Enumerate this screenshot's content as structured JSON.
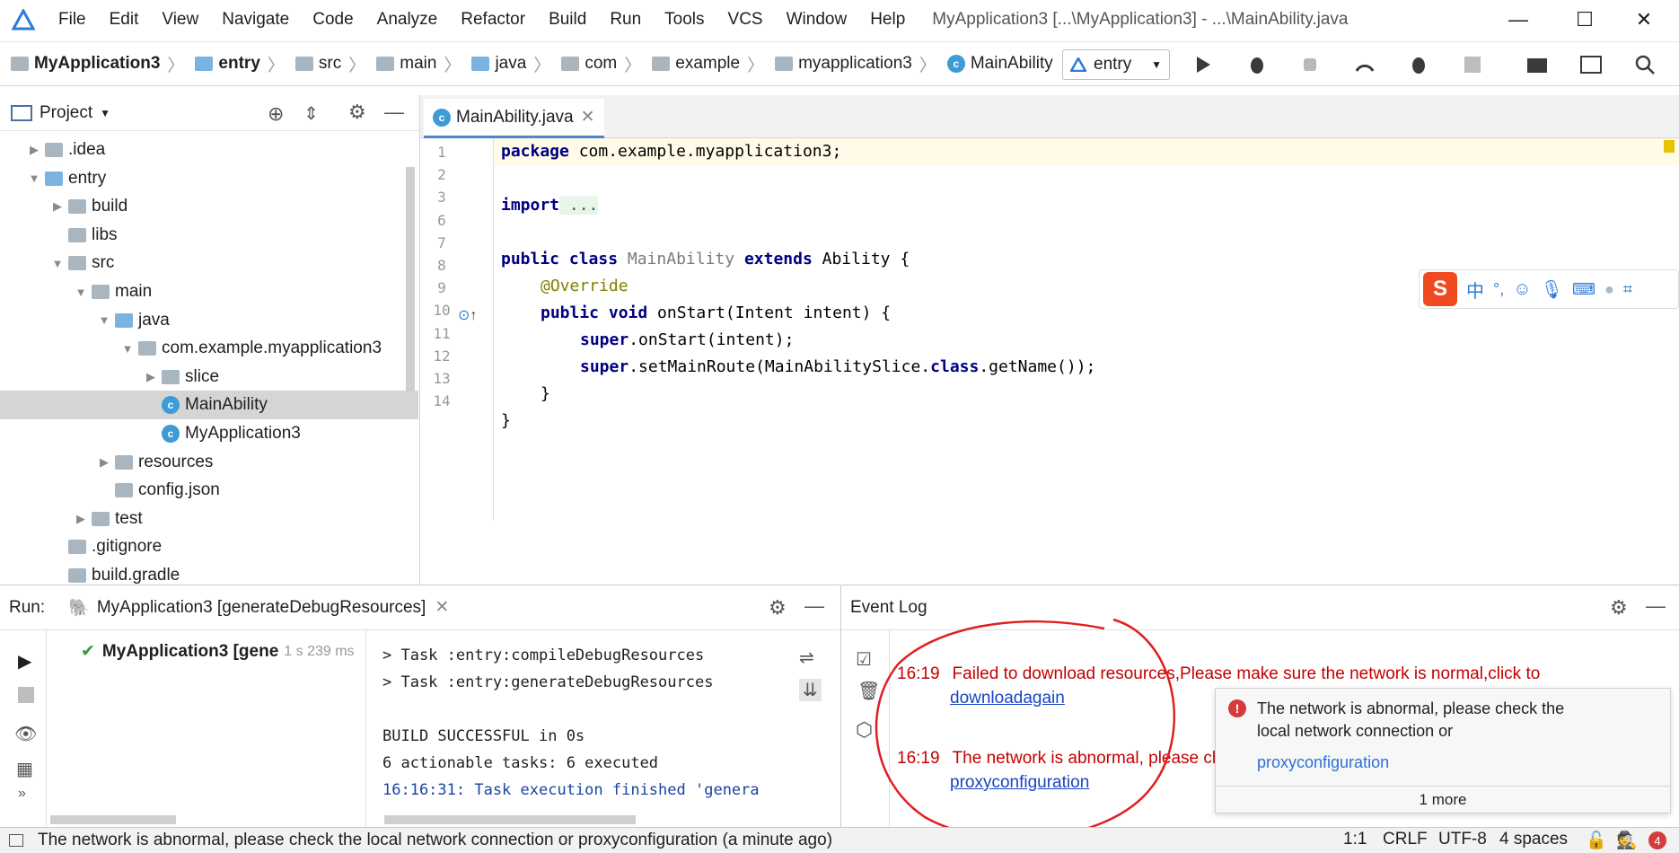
{
  "menubar": {
    "items": [
      "File",
      "Edit",
      "View",
      "Navigate",
      "Code",
      "Analyze",
      "Refactor",
      "Build",
      "Run",
      "Tools",
      "VCS",
      "Window",
      "Help"
    ],
    "title": "MyApplication3 [...\\MyApplication3] - ...\\MainAbility.java"
  },
  "navbar": {
    "crumbs": [
      "MyApplication3",
      "entry",
      "src",
      "main",
      "java",
      "com",
      "example",
      "myapplication3",
      "MainAbility"
    ],
    "run_config": "entry"
  },
  "project": {
    "header": "Project",
    "tree": [
      {
        "label": ".idea",
        "arrow": "▶",
        "indent": 0
      },
      {
        "label": "entry",
        "arrow": "▼",
        "indent": 0
      },
      {
        "label": "build",
        "arrow": "▶",
        "indent": 1
      },
      {
        "label": "libs",
        "arrow": "",
        "indent": 1
      },
      {
        "label": "src",
        "arrow": "▼",
        "indent": 1
      },
      {
        "label": "main",
        "arrow": "▼",
        "indent": 2
      },
      {
        "label": "java",
        "arrow": "▼",
        "indent": 3
      },
      {
        "label": "com.example.myapplication3",
        "arrow": "▼",
        "indent": 4
      },
      {
        "label": "slice",
        "arrow": "▶",
        "indent": 5
      },
      {
        "label": "MainAbility",
        "arrow": "",
        "indent": 5
      },
      {
        "label": "MyApplication3",
        "arrow": "",
        "indent": 5
      },
      {
        "label": "resources",
        "arrow": "▶",
        "indent": 3
      },
      {
        "label": "config.json",
        "arrow": "",
        "indent": 3
      },
      {
        "label": "test",
        "arrow": "▶",
        "indent": 2
      },
      {
        "label": ".gitignore",
        "arrow": "",
        "indent": 1
      },
      {
        "label": "build.gradle",
        "arrow": "",
        "indent": 1
      }
    ]
  },
  "editor": {
    "tab": "MainAbility.java",
    "line_numbers": [
      "1",
      "2",
      "3",
      "6",
      "7",
      "8",
      "9",
      "10",
      "11",
      "12",
      "13",
      "14"
    ],
    "code": {
      "l1_kw": "package",
      "l1_rest": " com.example.myapplication3;",
      "l3_kw": "import",
      "l3_rest": " ...",
      "l7_kw1": "public class",
      "l7_name": " MainAbility ",
      "l7_kw2": "extends",
      "l7_rest": " Ability {",
      "l8": "@Override",
      "l9_kw": "public void",
      "l9_rest": " onStart(Intent intent) {",
      "l10_kw": "super",
      "l10_rest": ".onStart(intent);",
      "l11_kw": "super",
      "l11_mid": ".setMainRoute(MainAbilitySlice.",
      "l11_kw2": "class",
      "l11_rest": ".getName());",
      "l12": "}",
      "l13": "}"
    }
  },
  "run": {
    "label": "Run:",
    "tab": "MyApplication3 [generateDebugResources]",
    "tree_item": "MyApplication3 [gene",
    "tree_time": "1 s 239 ms",
    "console": [
      "> Task :entry:compileDebugResources",
      "> Task :entry:generateDebugResources",
      "",
      "BUILD SUCCESSFUL in 0s",
      "6 actionable tasks: 6 executed",
      "16:16:31: Task execution finished 'genera"
    ]
  },
  "eventlog": {
    "title": "Event Log",
    "entries": [
      {
        "time": "16:19",
        "text": "Failed to download resources,Please make sure the network is normal,click to",
        "link": "downloadagain"
      },
      {
        "time": "16:19",
        "text": "The network is abnormal, please ch",
        "link": "proxyconfiguration"
      }
    ]
  },
  "balloon": {
    "text1": "The network is abnormal, please check the",
    "text2": "local network connection or",
    "link": "proxyconfiguration",
    "more": "1 more"
  },
  "ime": {
    "label": "中"
  },
  "status": {
    "message": "The network is abnormal, please check the local network connection or proxyconfiguration (a minute ago)",
    "position": "1:1",
    "line_sep": "CRLF",
    "encoding": "UTF-8",
    "indent": "4 spaces",
    "badge": "4"
  },
  "colors": {
    "accent": "#4a88c7",
    "error": "#c40000",
    "link": "#1a44c4",
    "selection": "#d5d5d5"
  }
}
